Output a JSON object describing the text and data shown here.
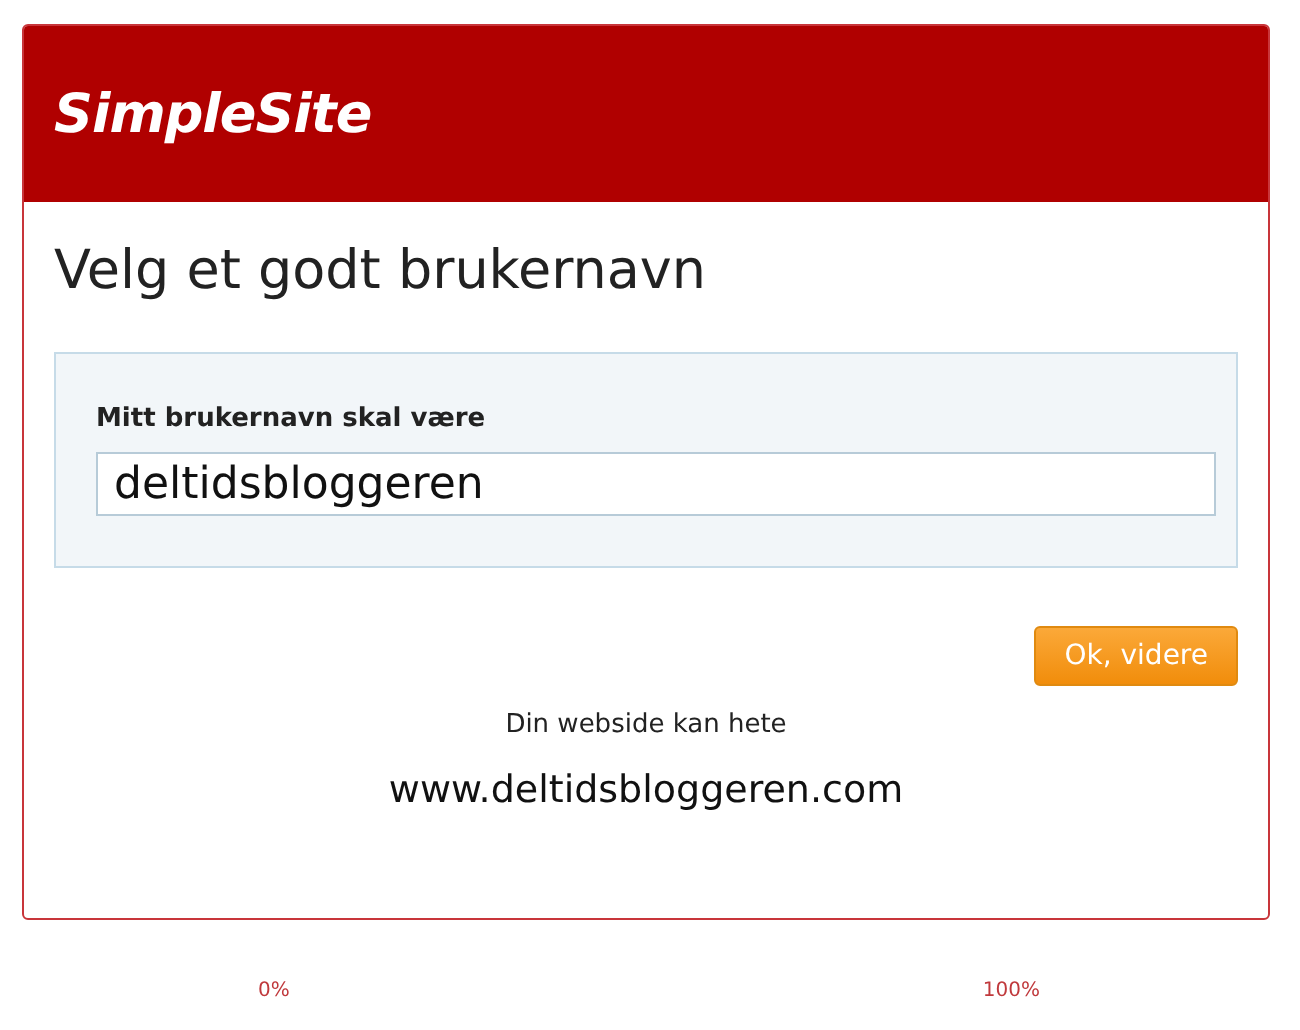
{
  "header": {
    "logo": "SimpleSite"
  },
  "title": "Velg et godt brukernavn",
  "username_field": {
    "label": "Mitt brukernavn skal være",
    "value": "deltidsbloggeren"
  },
  "button": "Ok, videre",
  "preview": {
    "caption": "Din webside kan hete",
    "url": "www.deltidsbloggeren.com"
  },
  "progress_labels": [
    "0%",
    "100%"
  ]
}
